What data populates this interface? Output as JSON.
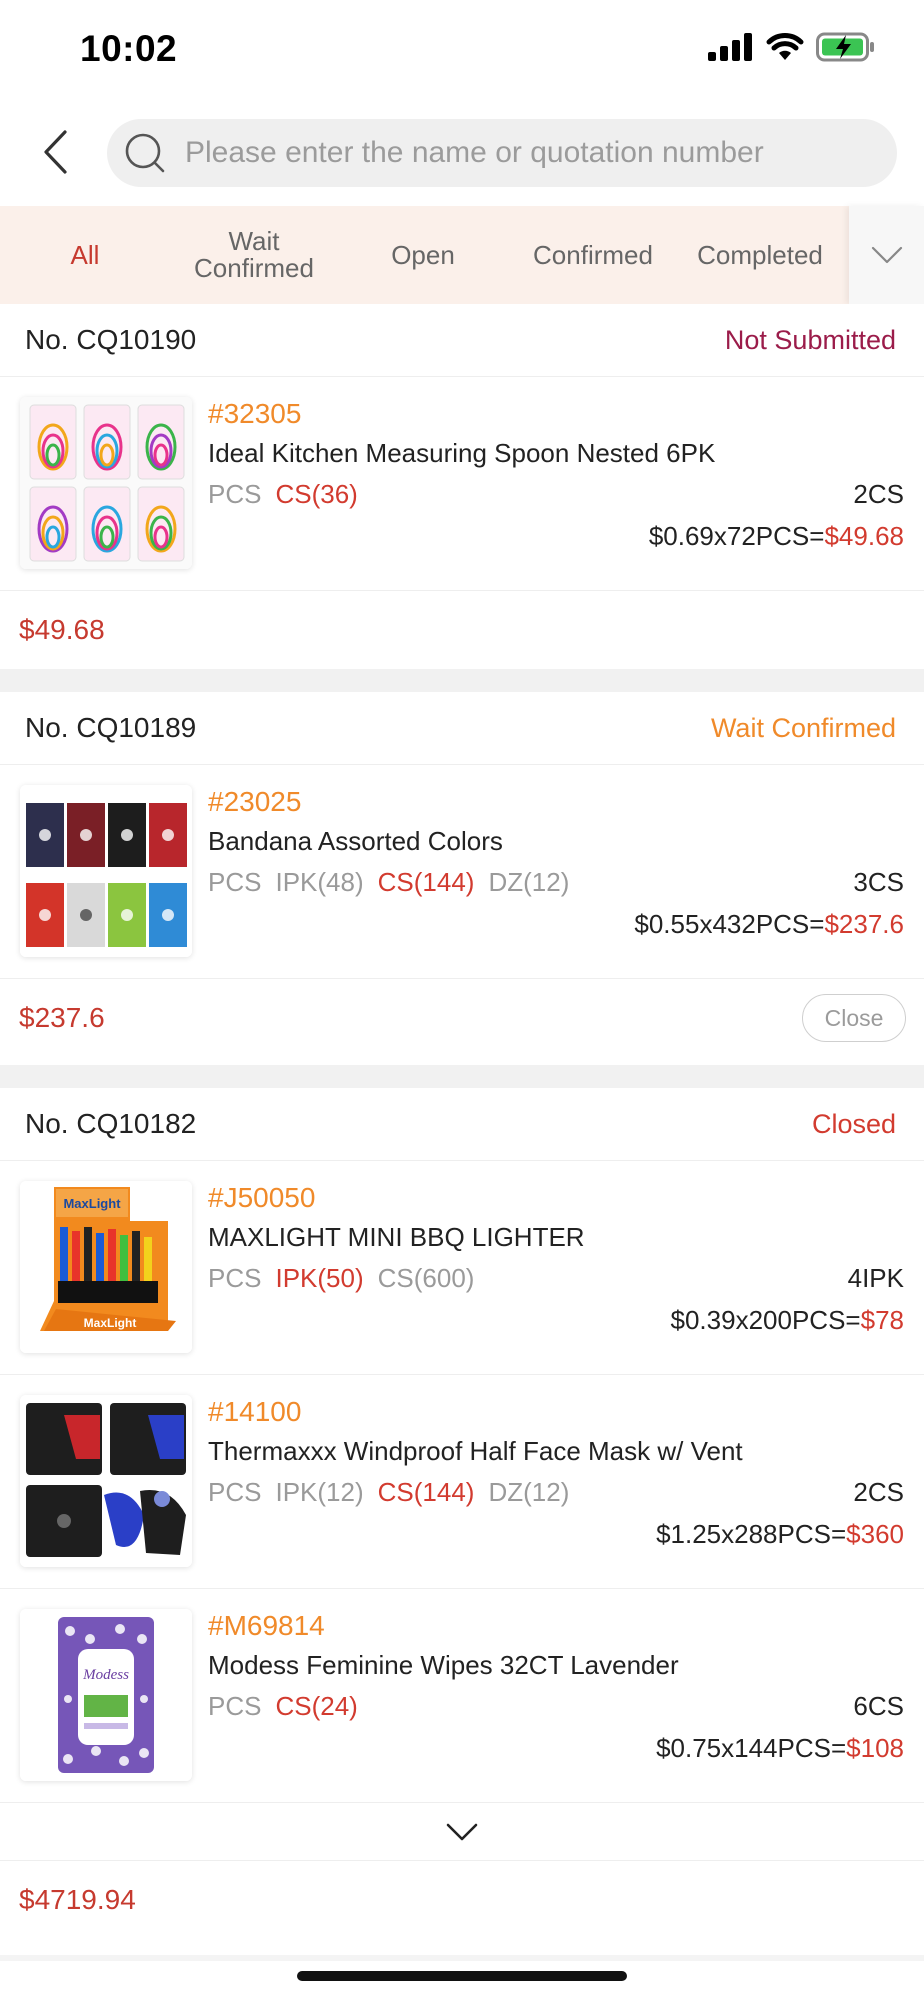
{
  "status_bar": {
    "time": "10:02"
  },
  "search": {
    "placeholder": "Please enter the name or quotation number"
  },
  "tabs": [
    {
      "label": "All",
      "active": true
    },
    {
      "label": "Wait Confirmed",
      "active": false
    },
    {
      "label": "Open",
      "active": false
    },
    {
      "label": "Confirmed",
      "active": false
    },
    {
      "label": "Completed",
      "active": false
    }
  ],
  "orders": [
    {
      "number": "No. CQ10190",
      "status": "Not Submitted",
      "status_color": "#9b1c4a",
      "products": [
        {
          "code": "#32305",
          "name": "Ideal Kitchen Measuring Spoon Nested 6PK",
          "units": [
            {
              "text": "PCS",
              "selected": false
            },
            {
              "text": "CS(36)",
              "selected": true
            }
          ],
          "qty": "2CS",
          "price": "$0.69x72PCS=",
          "subtotal": "$49.68",
          "image": "measuring-spoons"
        }
      ],
      "total": "$49.68",
      "close_label": null
    },
    {
      "number": "No. CQ10189",
      "status": "Wait Confirmed",
      "status_color": "#f08a2a",
      "products": [
        {
          "code": "#23025",
          "name": "Bandana Assorted Colors",
          "units": [
            {
              "text": "PCS",
              "selected": false
            },
            {
              "text": "IPK(48)",
              "selected": false
            },
            {
              "text": "CS(144)",
              "selected": true
            },
            {
              "text": "DZ(12)",
              "selected": false
            }
          ],
          "qty": "3CS",
          "price": "$0.55x432PCS=",
          "subtotal": "$237.6",
          "image": "bandanas"
        }
      ],
      "total": "$237.6",
      "close_label": "Close"
    },
    {
      "number": "No. CQ10182",
      "status": "Closed",
      "status_color": "#d23b2f",
      "products": [
        {
          "code": "#J50050",
          "name": "MAXLIGHT MINI BBQ LIGHTER",
          "units": [
            {
              "text": "PCS",
              "selected": false
            },
            {
              "text": "IPK(50)",
              "selected": true
            },
            {
              "text": "CS(600)",
              "selected": false
            }
          ],
          "qty": "4IPK",
          "price": "$0.39x200PCS=",
          "subtotal": "$78",
          "image": "lighters",
          "image_text": "MaxLight"
        },
        {
          "code": "#14100",
          "name": "Thermaxxx Windproof Half Face Mask w/ Vent",
          "units": [
            {
              "text": "PCS",
              "selected": false
            },
            {
              "text": "IPK(12)",
              "selected": false
            },
            {
              "text": "CS(144)",
              "selected": true
            },
            {
              "text": "DZ(12)",
              "selected": false
            }
          ],
          "qty": "2CS",
          "price": "$1.25x288PCS=",
          "subtotal": "$360",
          "image": "face-masks"
        },
        {
          "code": "#M69814",
          "name": "Modess Feminine Wipes 32CT Lavender",
          "units": [
            {
              "text": "PCS",
              "selected": false
            },
            {
              "text": "CS(24)",
              "selected": true
            }
          ],
          "qty": "6CS",
          "price": "$0.75x144PCS=",
          "subtotal": "$108",
          "image": "wipes",
          "image_text": "Modess"
        }
      ],
      "total": "$4719.94",
      "close_label": null
    }
  ]
}
